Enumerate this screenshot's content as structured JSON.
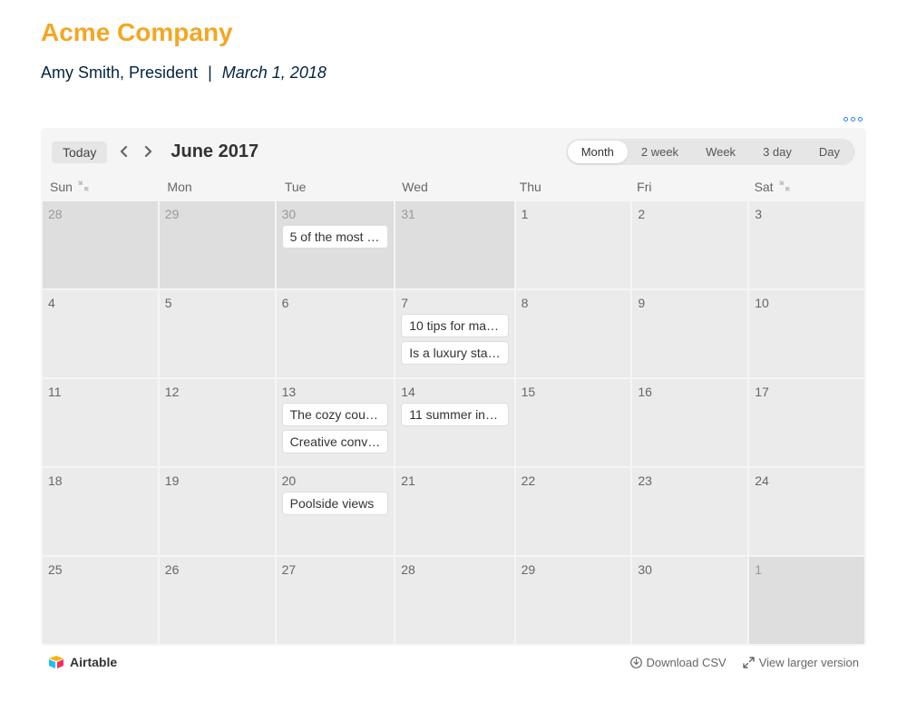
{
  "header": {
    "title": "Acme Company",
    "author": "Amy Smith, President",
    "separator": "|",
    "date": "March 1, 2018"
  },
  "toolbar": {
    "today_label": "Today",
    "month_label": "June 2017",
    "views": [
      "Month",
      "2 week",
      "Week",
      "3 day",
      "Day"
    ],
    "active_view": "Month"
  },
  "daynames": [
    "Sun",
    "Mon",
    "Tue",
    "Wed",
    "Thu",
    "Fri",
    "Sat"
  ],
  "weeks": [
    [
      {
        "num": "28",
        "other": true,
        "events": []
      },
      {
        "num": "29",
        "other": true,
        "events": []
      },
      {
        "num": "30",
        "other": true,
        "events": [
          "5 of the most …"
        ]
      },
      {
        "num": "31",
        "other": true,
        "events": []
      },
      {
        "num": "1",
        "other": false,
        "events": []
      },
      {
        "num": "2",
        "other": false,
        "events": []
      },
      {
        "num": "3",
        "other": false,
        "events": []
      }
    ],
    [
      {
        "num": "4",
        "other": false,
        "events": []
      },
      {
        "num": "5",
        "other": false,
        "events": []
      },
      {
        "num": "6",
        "other": false,
        "events": []
      },
      {
        "num": "7",
        "other": false,
        "events": [
          "10 tips for ma…",
          "Is a luxury sta…"
        ]
      },
      {
        "num": "8",
        "other": false,
        "events": []
      },
      {
        "num": "9",
        "other": false,
        "events": []
      },
      {
        "num": "10",
        "other": false,
        "events": []
      }
    ],
    [
      {
        "num": "11",
        "other": false,
        "events": []
      },
      {
        "num": "12",
        "other": false,
        "events": []
      },
      {
        "num": "13",
        "other": false,
        "events": [
          "The cozy cou…",
          "Creative conv…"
        ]
      },
      {
        "num": "14",
        "other": false,
        "events": [
          "11 summer in…"
        ]
      },
      {
        "num": "15",
        "other": false,
        "events": []
      },
      {
        "num": "16",
        "other": false,
        "events": []
      },
      {
        "num": "17",
        "other": false,
        "events": []
      }
    ],
    [
      {
        "num": "18",
        "other": false,
        "events": []
      },
      {
        "num": "19",
        "other": false,
        "events": []
      },
      {
        "num": "20",
        "other": false,
        "events": [
          "Poolside views"
        ]
      },
      {
        "num": "21",
        "other": false,
        "events": []
      },
      {
        "num": "22",
        "other": false,
        "events": []
      },
      {
        "num": "23",
        "other": false,
        "events": []
      },
      {
        "num": "24",
        "other": false,
        "events": []
      }
    ],
    [
      {
        "num": "25",
        "other": false,
        "events": []
      },
      {
        "num": "26",
        "other": false,
        "events": []
      },
      {
        "num": "27",
        "other": false,
        "events": []
      },
      {
        "num": "28",
        "other": false,
        "events": []
      },
      {
        "num": "29",
        "other": false,
        "events": []
      },
      {
        "num": "30",
        "other": false,
        "events": []
      },
      {
        "num": "1",
        "other": true,
        "events": []
      }
    ]
  ],
  "footer": {
    "brand": "Airtable",
    "download_csv": "Download CSV",
    "view_larger": "View larger version"
  }
}
